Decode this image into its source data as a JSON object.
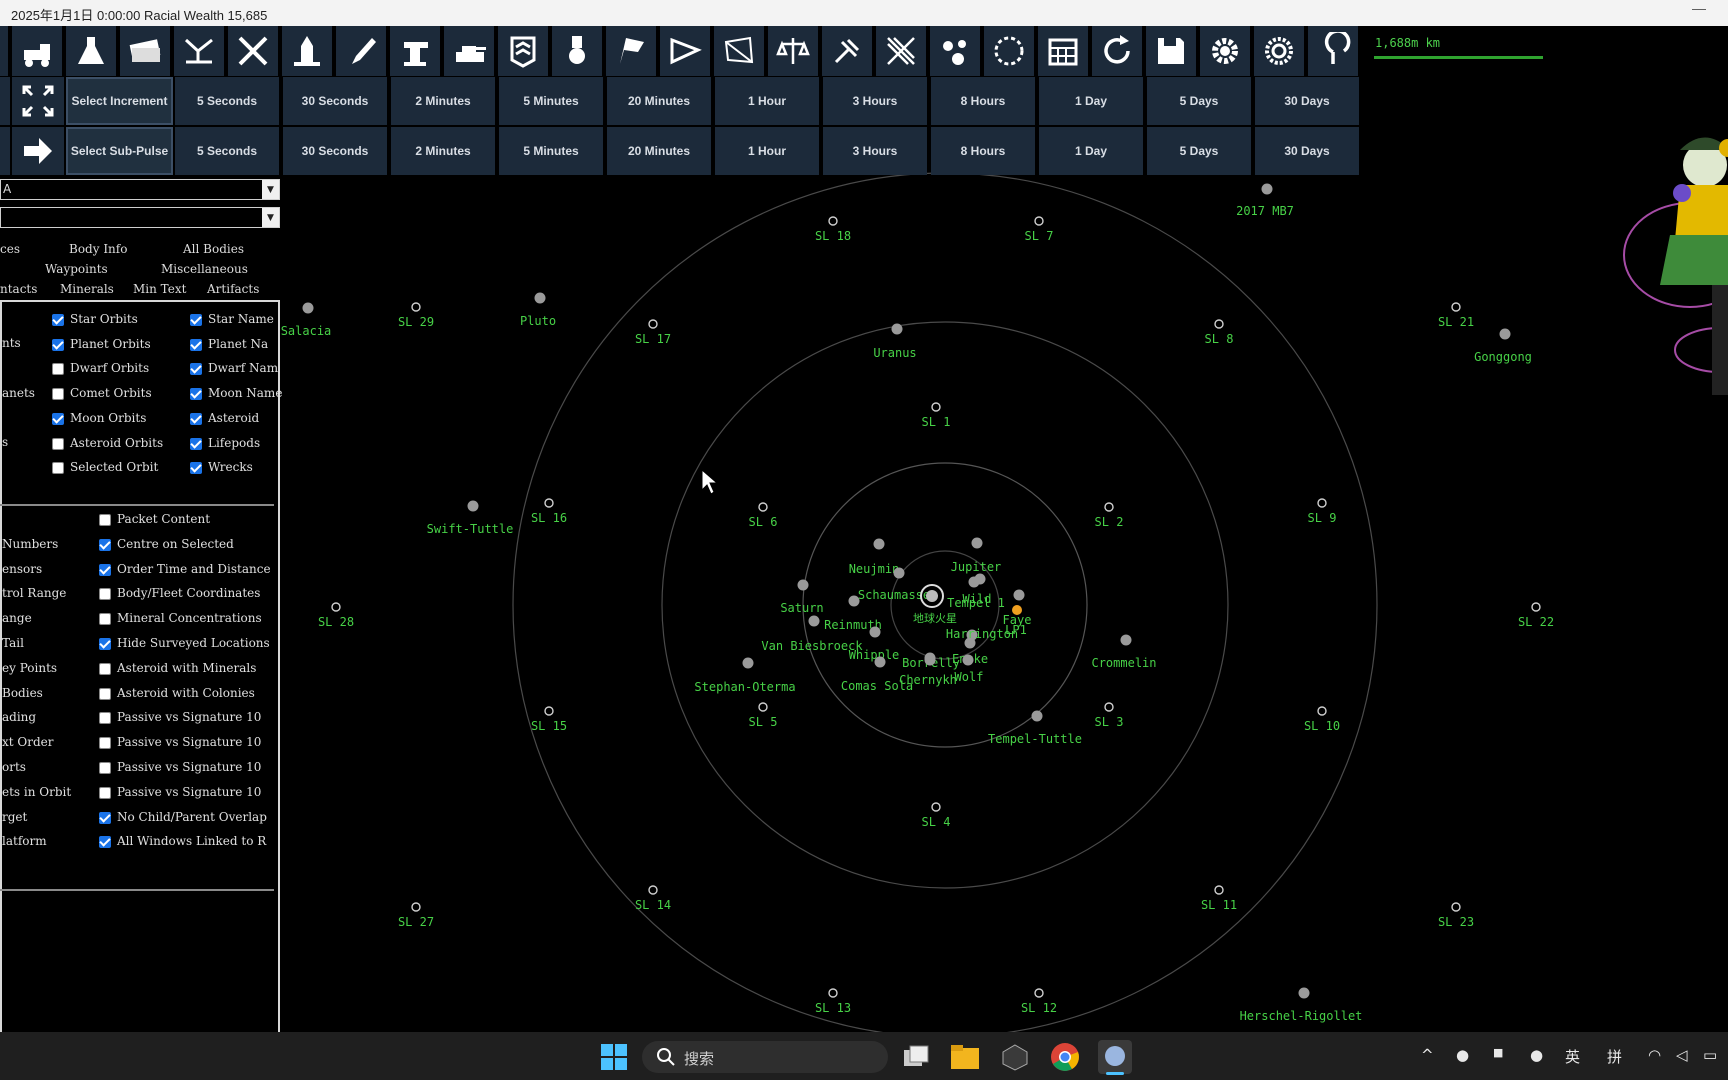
{
  "title_bar": {
    "text": "2025年1月1日 0:00:00   Racial Wealth 15,685",
    "minimize": "—"
  },
  "toolbar": {
    "icons": [
      "blank-icon",
      "truck-icon",
      "flask-icon",
      "money-icon",
      "connection-icon",
      "crossed-tools-icon",
      "launch-pad-icon",
      "brush-icon",
      "turret-icon",
      "tank-icon",
      "rank-icon",
      "medal-icon",
      "flag-icon",
      "comet-icon",
      "constellation-icon",
      "scales-icon",
      "satellite-icon",
      "grid-icon",
      "asteroid-icon",
      "globe-icon",
      "calendar-icon",
      "refresh-icon",
      "save-icon",
      "gear-icon",
      "gear-alt-icon",
      "spiral-icon"
    ]
  },
  "scale_readout": "1,688m km",
  "increment_row": {
    "select_label": "Select Increment",
    "buttons": [
      "5 Seconds",
      "30 Seconds",
      "2 Minutes",
      "5 Minutes",
      "20 Minutes",
      "1 Hour",
      "3 Hours",
      "8 Hours",
      "1 Day",
      "5 Days",
      "30 Days"
    ]
  },
  "subpulse_row": {
    "select_label": "Select Sub-Pulse",
    "buttons": [
      "5 Seconds",
      "30 Seconds",
      "2 Minutes",
      "5 Minutes",
      "20 Minutes",
      "1 Hour",
      "3 Hours",
      "8 Hours",
      "1 Day",
      "5 Days",
      "30 Days"
    ]
  },
  "side_panel": {
    "combo1_value": "A",
    "combo2_value": "",
    "tabs_row1": [
      "ces",
      "Body Info",
      "All Bodies"
    ],
    "tabs_row2": [
      "Waypoints",
      "Miscellaneous"
    ],
    "tabs_row3": [
      "ntacts",
      "Minerals",
      "Min Text",
      "Artifacts"
    ],
    "group1_left": [
      "nts",
      "anets",
      "s"
    ],
    "group1_col1": [
      {
        "label": "Star Orbits",
        "checked": true
      },
      {
        "label": "Planet Orbits",
        "checked": true
      },
      {
        "label": "Dwarf Orbits",
        "checked": false
      },
      {
        "label": "Comet Orbits",
        "checked": false
      },
      {
        "label": "Moon Orbits",
        "checked": true
      },
      {
        "label": "Asteroid Orbits",
        "checked": false
      },
      {
        "label": "Selected Orbit",
        "checked": false
      }
    ],
    "group1_col2": [
      {
        "label": "Star Name",
        "checked": true
      },
      {
        "label": "Planet Na",
        "checked": true
      },
      {
        "label": "Dwarf Nam",
        "checked": true
      },
      {
        "label": "Moon Name",
        "checked": true
      },
      {
        "label": "Asteroid ",
        "checked": true
      },
      {
        "label": "Lifepods",
        "checked": true
      },
      {
        "label": "Wrecks",
        "checked": true
      }
    ],
    "group2_left": [
      "",
      "Numbers",
      "ensors",
      "trol Range",
      "ange",
      "Tail",
      "ey Points",
      "Bodies",
      "ading",
      "xt Order",
      "orts",
      "ets in Orbit",
      "rget",
      "latform"
    ],
    "group2_right": [
      {
        "label": "Packet Content",
        "checked": false
      },
      {
        "label": "Centre on Selected",
        "checked": true
      },
      {
        "label": "Order Time and Distance",
        "checked": true
      },
      {
        "label": "Body/Fleet Coordinates",
        "checked": false
      },
      {
        "label": "Mineral Concentrations",
        "checked": false
      },
      {
        "label": "Hide Surveyed Locations",
        "checked": true
      },
      {
        "label": "Asteroid with Minerals",
        "checked": false
      },
      {
        "label": "Asteroid with Colonies",
        "checked": false
      },
      {
        "label": "Passive vs Signature 10",
        "checked": false
      },
      {
        "label": "Passive vs Signature 10",
        "checked": false
      },
      {
        "label": "Passive vs Signature 10",
        "checked": false
      },
      {
        "label": "Passive vs Signature 10",
        "checked": false
      },
      {
        "label": "No Child/Parent Overlap",
        "checked": true
      },
      {
        "label": "All Windows Linked to R",
        "checked": true
      }
    ]
  },
  "map": {
    "survey_locations": [
      "SL 1",
      "SL 2",
      "SL 3",
      "SL 4",
      "SL 5",
      "SL 6",
      "SL 7",
      "SL 8",
      "SL 9",
      "SL 10",
      "SL 11",
      "SL 12",
      "SL 13",
      "SL 14",
      "SL 15",
      "SL 16",
      "SL 17",
      "SL 18",
      "SL 21",
      "SL 22",
      "SL 23",
      "SL 27",
      "SL 28",
      "SL 29"
    ],
    "bodies": [
      "2017 MB7",
      "Salacia",
      "Pluto",
      "Uranus",
      "Gonggong",
      "Swift-Tuttle",
      "Neujmin",
      "Jupiter",
      "Schaumasse",
      "Tempel 1",
      "Wild",
      "Faye",
      "Saturn",
      "Reinmuth",
      "LP1",
      "Van Biesbroeck",
      "Whipple",
      "Encke",
      "Borrelly",
      "Harrington",
      "Chernykh",
      "Wolf",
      "Comas Sola",
      "Stephan-Oterma",
      "Crommelin",
      "Tempel-Tuttle",
      "Herschel-Rigollet"
    ],
    "inner_cluster_text": "地球火星"
  },
  "taskbar": {
    "search_placeholder": "搜索",
    "tray_ime_1": "英",
    "tray_ime_2": "拼"
  }
}
